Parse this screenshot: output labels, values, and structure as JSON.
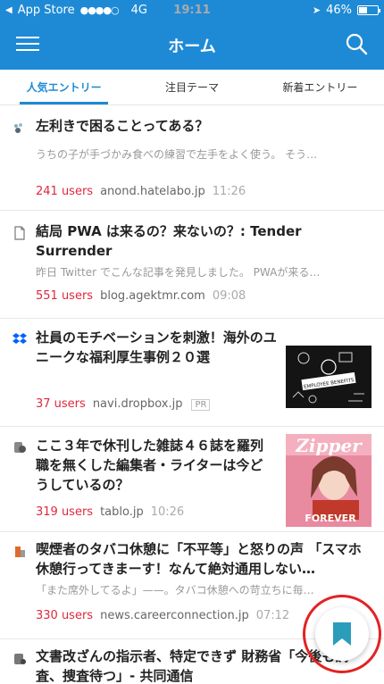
{
  "status": {
    "carrier": "App Store",
    "signal_dots": "●●●●○",
    "network": "4G",
    "time": "19:11",
    "battery": "46%"
  },
  "nav": {
    "title": "ホーム"
  },
  "tabs": [
    "人気エントリー",
    "注目テーマ",
    "新着エントリー"
  ],
  "entries": [
    {
      "title": "左利きで困ることってある？",
      "snippet": "うちの子が手づかみ食べの練習で左手をよく使う。 そう…",
      "users": "241 users",
      "domain": "anond.hatelabo.jp",
      "time": "11:26"
    },
    {
      "title": "結局 PWA は来るの？来ないの？: Tender Surrender",
      "snippet": "昨日 Twitter でこんな記事を発見しました。 PWAが来る…",
      "users": "551 users",
      "domain": "blog.agektmr.com",
      "time": "09:08"
    },
    {
      "title": "社員のモチベーションを刺激！海外のユニークな福利厚生事例２０選",
      "users": "37 users",
      "domain": "navi.dropbox.jp",
      "pr": "PR"
    },
    {
      "title": "ここ３年で休刊した雑誌４６誌を羅列 職を無くした編集者・ライターは今どうしているの？",
      "users": "319 users",
      "domain": "tablo.jp",
      "time": "10:26"
    },
    {
      "title": "喫煙者のタバコ休憩に「不平等」と怒りの声 「スマホ休憩行ってきまーす！なんて絶対通用しない…",
      "snippet": "「また席外してるよ」——。タバコ休憩への苛立ちに毎…",
      "users": "330 users",
      "domain": "news.careerconnection.jp",
      "time": "07:12"
    },
    {
      "title": "文書改ざんの指示者、特定できず 財務省「今後も調査、捜査待つ」- 共同通信"
    }
  ],
  "thumb_texts": {
    "benefits": "EMPLOYEE BENEFITS",
    "zipper": "Zipper",
    "forever": "FOREVER"
  },
  "colors": {
    "accent": "#1e8ad6",
    "users": "#e0283c",
    "fab_ring": "#e32222",
    "bookmark": "#2a9dbb"
  }
}
